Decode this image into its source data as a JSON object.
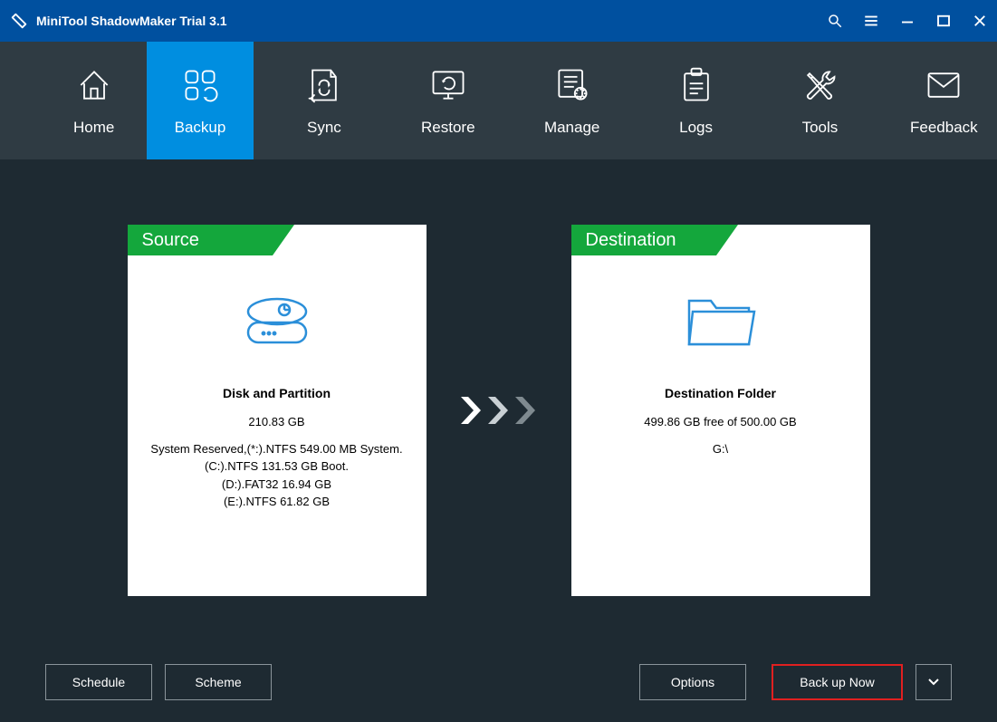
{
  "title": "MiniTool ShadowMaker Trial 3.1",
  "nav": {
    "home": "Home",
    "backup": "Backup",
    "sync": "Sync",
    "restore": "Restore",
    "manage": "Manage",
    "logs": "Logs",
    "tools": "Tools",
    "feedback": "Feedback"
  },
  "source": {
    "header": "Source",
    "title": "Disk and Partition",
    "size": "210.83 GB",
    "line1": "System Reserved,(*:).NTFS 549.00 MB System.",
    "line2": "(C:).NTFS 131.53 GB Boot.",
    "line3": "(D:).FAT32 16.94 GB",
    "line4": "(E:).NTFS 61.82 GB"
  },
  "destination": {
    "header": "Destination",
    "title": "Destination Folder",
    "free": "499.86 GB free of 500.00 GB",
    "path": "G:\\"
  },
  "buttons": {
    "schedule": "Schedule",
    "scheme": "Scheme",
    "options": "Options",
    "backup_now": "Back up Now"
  }
}
